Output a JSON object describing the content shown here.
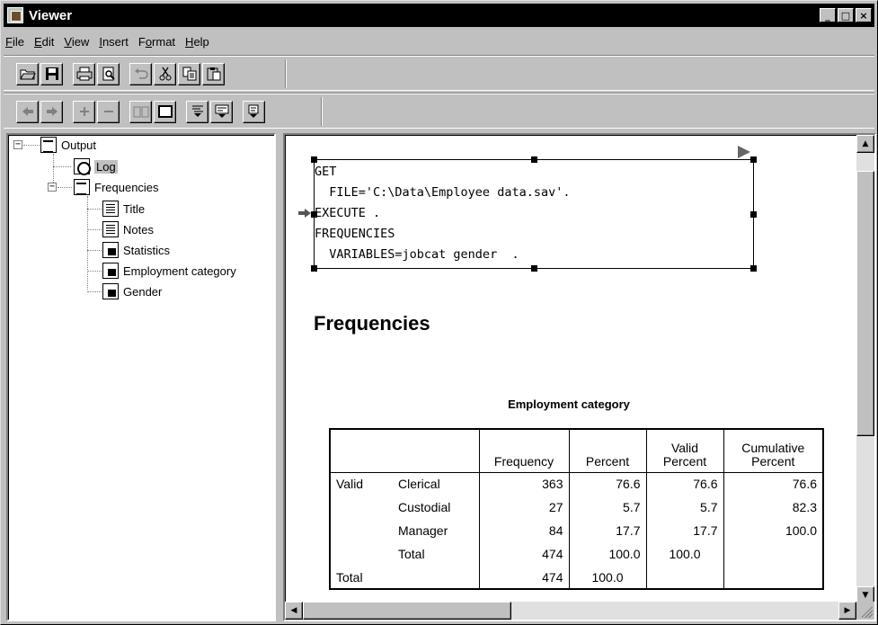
{
  "window": {
    "title": "Viewer",
    "controls": {
      "minimize": "_",
      "maximize": "□",
      "close": "×"
    }
  },
  "menu": [
    {
      "key": "F",
      "rest": "ile"
    },
    {
      "key": "E",
      "rest": "dit"
    },
    {
      "key": "V",
      "rest": "iew"
    },
    {
      "key": "I",
      "rest": "nsert"
    },
    {
      "pre": "F",
      "key": "o",
      "rest": "rmat"
    },
    {
      "key": "H",
      "rest": "elp"
    }
  ],
  "toolbar1": {
    "open_icon": "open-folder-icon",
    "save_icon": "save-disk-icon",
    "print_icon": "printer-icon",
    "preview_icon": "print-preview-icon",
    "undo_icon": "undo-icon",
    "cut_icon": "scissors-icon",
    "copy_icon": "copy-icon",
    "paste_icon": "paste-icon"
  },
  "outline": {
    "root": "Output",
    "log": "Log",
    "frequencies": "Frequencies",
    "children": [
      "Title",
      "Notes",
      "Statistics",
      "Employment category",
      "Gender"
    ]
  },
  "syntax": {
    "lines": [
      "GET",
      "  FILE='C:\\Data\\Employee data.sav'.",
      "EXECUTE .",
      "FREQUENCIES",
      "  VARIABLES=jobcat gender  ."
    ]
  },
  "content": {
    "heading": "Frequencies",
    "table_title": "Employment category",
    "headers": {
      "frequency": "Frequency",
      "percent": "Percent",
      "valid_percent_1": "Valid",
      "valid_percent_2": "Percent",
      "cumulative_percent_1": "Cumulative",
      "cumulative_percent_2": "Percent"
    },
    "rows": [
      {
        "group": "Valid",
        "label": "Clerical",
        "frequency": "363",
        "percent": "76.6",
        "valid_percent": "76.6",
        "cumulative_percent": "76.6"
      },
      {
        "group": "",
        "label": "Custodial",
        "frequency": "27",
        "percent": "5.7",
        "valid_percent": "5.7",
        "cumulative_percent": "82.3"
      },
      {
        "group": "",
        "label": "Manager",
        "frequency": "84",
        "percent": "17.7",
        "valid_percent": "17.7",
        "cumulative_percent": "100.0"
      },
      {
        "group": "",
        "label": "Total",
        "frequency": "474",
        "percent": "100.0",
        "valid_percent": "100.0",
        "cumulative_percent": ""
      },
      {
        "group": "Total",
        "label": "",
        "frequency": "474",
        "percent": "100.0",
        "valid_percent": "",
        "cumulative_percent": ""
      }
    ]
  }
}
